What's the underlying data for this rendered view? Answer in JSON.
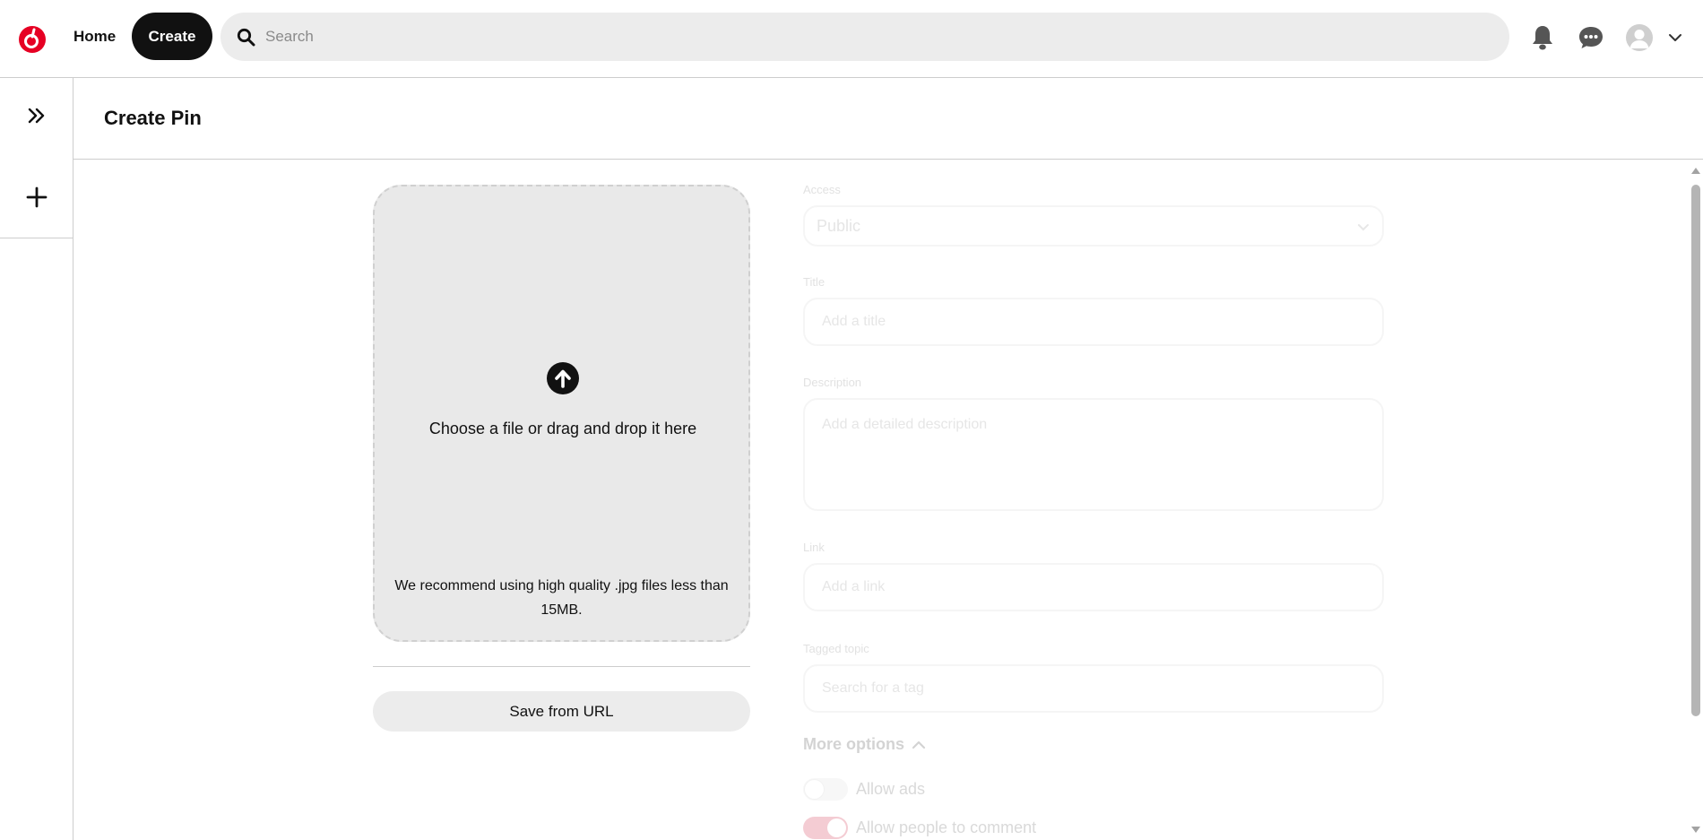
{
  "nav": {
    "home_label": "Home",
    "create_label": "Create",
    "search_placeholder": "Search",
    "brand_color": "#e60023"
  },
  "page": {
    "title": "Create Pin"
  },
  "upload": {
    "main_text": "Choose a file or drag and drop it here",
    "hint": "We recommend using high quality .jpg files less than 15MB.",
    "save_url_label": "Save from URL"
  },
  "form": {
    "access": {
      "label": "Access",
      "value": "Public"
    },
    "title": {
      "label": "Title",
      "placeholder": "Add a title"
    },
    "description": {
      "label": "Description",
      "placeholder": "Add a detailed description"
    },
    "link": {
      "label": "Link",
      "placeholder": "Add a link"
    },
    "tagged_topic": {
      "label": "Tagged topic",
      "placeholder": "Search for a tag"
    },
    "more_options_label": "More options",
    "toggles": [
      {
        "label": "Allow ads",
        "on": false
      },
      {
        "label": "Allow people to comment",
        "on": true
      }
    ]
  },
  "icons": {
    "logo": "brand-logo-icon",
    "search": "search-icon",
    "notifications": "bell-icon",
    "messages": "chat-bubble-icon",
    "avatar": "avatar",
    "account_menu": "chevron-down-icon",
    "rail_expand": "double-chevron-right-icon",
    "rail_add": "plus-icon",
    "upload": "upload-arrow-icon"
  }
}
